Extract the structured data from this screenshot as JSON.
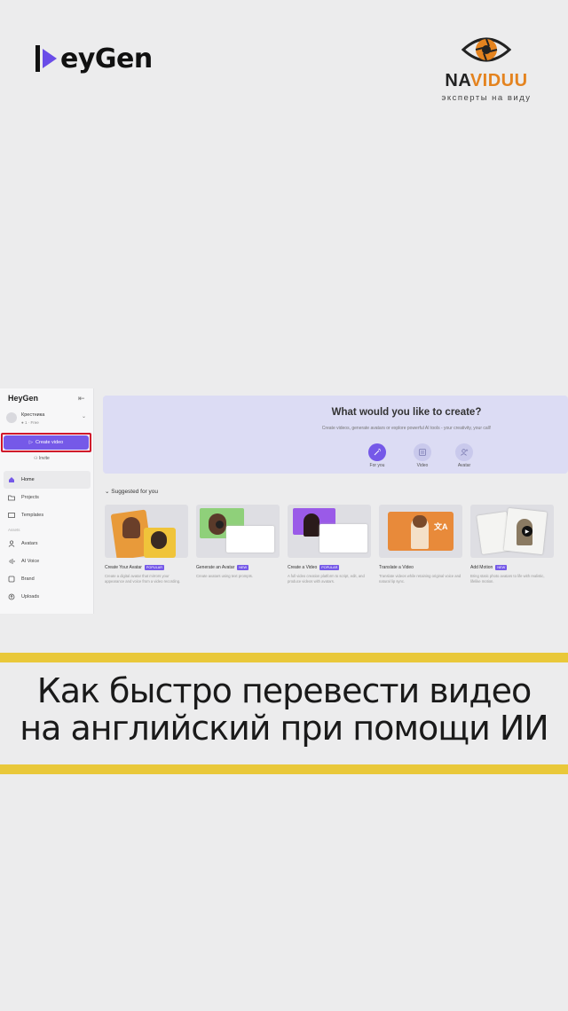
{
  "brand": {
    "logo_text": "eyGen"
  },
  "partner": {
    "name_a": "NA",
    "name_b": "VIDUU",
    "tagline": "эксперты на виду"
  },
  "sidebar": {
    "logo": "HeyGen",
    "user_name": "Крестника",
    "user_plan": "● 1 · Free",
    "create_label": "Create video",
    "invite_label": "Invite",
    "items_top": [
      {
        "label": "Home"
      },
      {
        "label": "Projects"
      },
      {
        "label": "Templates"
      }
    ],
    "section_label": "Assets",
    "items_bottom": [
      {
        "label": "Avatars"
      },
      {
        "label": "AI Voice"
      },
      {
        "label": "Brand"
      },
      {
        "label": "Uploads"
      }
    ]
  },
  "hero": {
    "title": "What would you like to create?",
    "subtitle": "Create videos, generate avatars or explore powerful AI tools - your creativity, your call!",
    "options": [
      {
        "label": "For you"
      },
      {
        "label": "Video"
      },
      {
        "label": "Avatar"
      }
    ]
  },
  "suggested": {
    "title": "Suggested for you",
    "cards": [
      {
        "title": "Create Your Avatar",
        "badge": "POPULAR",
        "desc": "Create a digital avatar that mirrors your appearance and voice from a video recording."
      },
      {
        "title": "Generate an Avatar",
        "badge": "NEW",
        "desc": "Create avatars using text prompts."
      },
      {
        "title": "Create a Video",
        "badge": "POPULAR",
        "desc": "A full video creation platform to script, edit, and produce videos with avatars."
      },
      {
        "title": "Translate a Video",
        "badge": "",
        "desc": "Translate videos while retaining original voice and natural lip sync."
      },
      {
        "title": "Add Motion",
        "badge": "NEW",
        "desc": "Bring static photo avatars to life with realistic, lifelike motion."
      }
    ]
  },
  "headline": {
    "line1": "Как быстро перевести видео",
    "line2": "на английский при помощи ИИ"
  },
  "colors": {
    "accent": "#7559e8",
    "highlight": "#d0142a",
    "stripe": "#e9c83a",
    "partner_orange": "#e4831f"
  }
}
